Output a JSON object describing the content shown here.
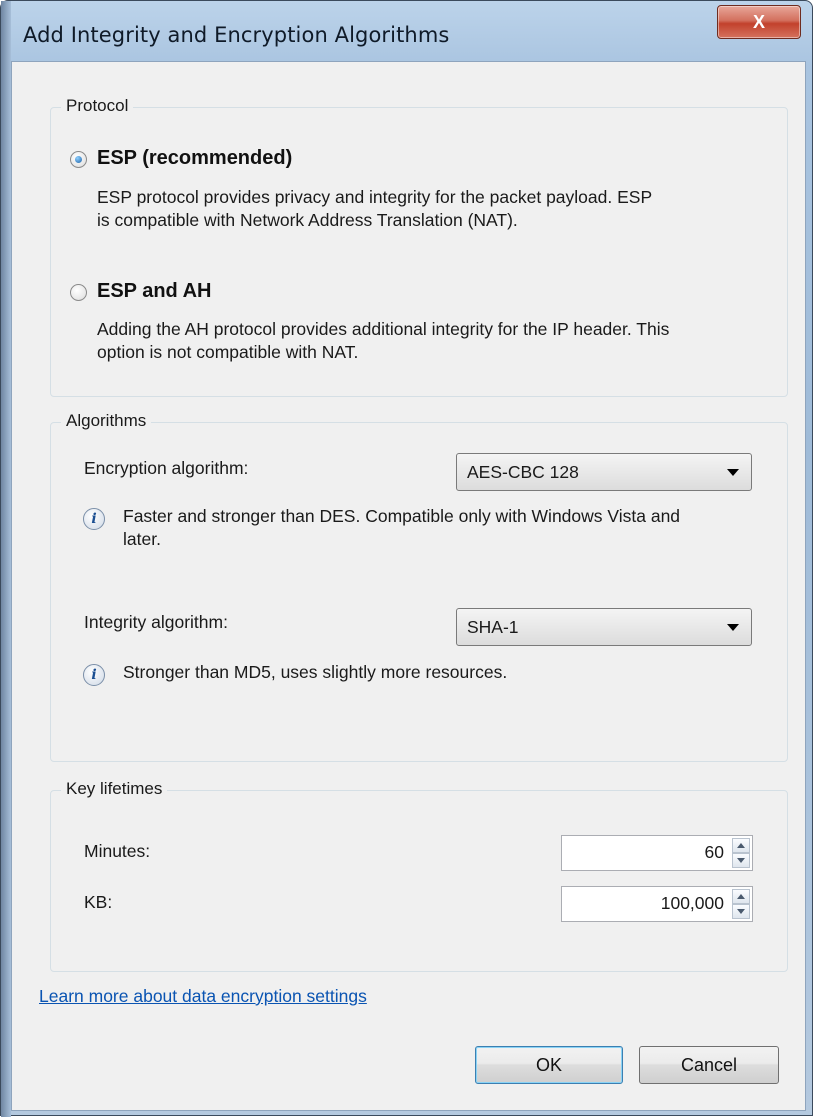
{
  "window": {
    "title": "Add Integrity and Encryption Algorithms",
    "close_glyph": "X"
  },
  "protocol": {
    "legend": "Protocol",
    "options": [
      {
        "label": "ESP (recommended)",
        "selected": true,
        "description": "ESP protocol provides privacy and integrity for the packet payload. ESP is compatible with Network Address Translation (NAT)."
      },
      {
        "label": "ESP and AH",
        "selected": false,
        "description": "Adding the AH protocol provides additional integrity for the IP header. This option is not compatible with NAT."
      }
    ]
  },
  "algorithms": {
    "legend": "Algorithms",
    "encryption": {
      "label": "Encryption algorithm:",
      "value": "AES-CBC 128",
      "info": "Faster and stronger than DES. Compatible only with Windows Vista and later."
    },
    "integrity": {
      "label": "Integrity algorithm:",
      "value": "SHA-1",
      "info": "Stronger than MD5, uses slightly more resources."
    }
  },
  "key_lifetimes": {
    "legend": "Key lifetimes",
    "minutes": {
      "label": "Minutes:",
      "value": "60"
    },
    "kb": {
      "label": "KB:",
      "value": "100,000"
    }
  },
  "link": "Learn more about data encryption settings",
  "buttons": {
    "ok": "OK",
    "cancel": "Cancel"
  },
  "icons": {
    "info": "information-icon",
    "close": "close-icon",
    "dropdown": "chevron-down-icon"
  }
}
